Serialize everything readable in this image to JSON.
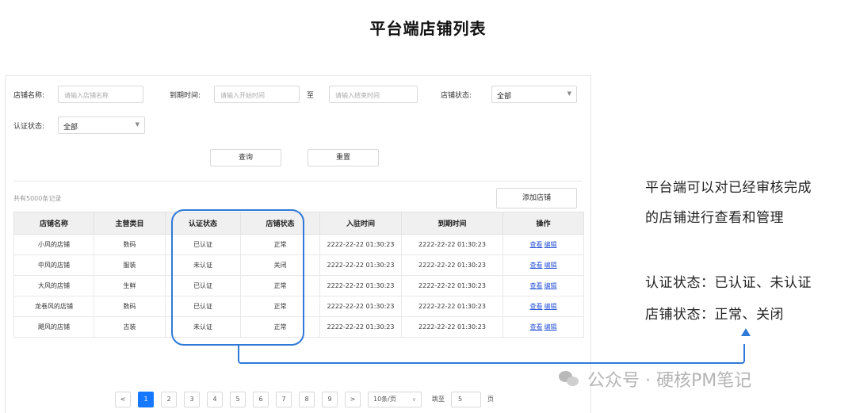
{
  "title": "平台端店铺列表",
  "filters": {
    "store_name_label": "店铺名称:",
    "store_name_placeholder": "请输入店铺名称",
    "expire_label": "到期时间:",
    "start_placeholder": "请输入开始时间",
    "to": "至",
    "end_placeholder": "请输入结束时间",
    "store_status_label": "店铺状态:",
    "store_status_value": "全部",
    "cert_status_label": "认证状态:",
    "cert_status_value": "全部"
  },
  "buttons": {
    "query": "查询",
    "reset": "重置",
    "add_store": "添加店铺"
  },
  "total_text": "共有5000条记录",
  "table": {
    "headers": [
      "店铺名称",
      "主营类目",
      "认证状态",
      "店铺状态",
      "入驻时间",
      "到期时间",
      "操作"
    ],
    "rows": [
      [
        "小风的店铺",
        "数码",
        "已认证",
        "正常",
        "2222-22-22 01:30:23",
        "2222-22-22 01:30:23"
      ],
      [
        "中风的店铺",
        "服装",
        "未认证",
        "关闭",
        "2222-22-22 01:30:23",
        "2222-22-22 01:30:23"
      ],
      [
        "大风的店铺",
        "生鲜",
        "已认证",
        "正常",
        "2222-22-22 01:30:23",
        "2222-22-22 01:30:23"
      ],
      [
        "龙卷风的店铺",
        "数码",
        "已认证",
        "正常",
        "2222-22-22 01:30:23",
        "2222-22-22 01:30:23"
      ],
      [
        "飓风的店铺",
        "古装",
        "未认证",
        "正常",
        "2222-22-22 01:30:23",
        "2222-22-22 01:30:23"
      ]
    ],
    "view_label": "查看",
    "edit_label": "编辑"
  },
  "annotations": {
    "line1": "平台端可以对已经审核完成",
    "line2": "的店铺进行查看和管理",
    "line3": "认证状态：已认证、未认证",
    "line4": "店铺状态：正常、关闭"
  },
  "pagination": {
    "prev": "<",
    "pages": [
      "1",
      "2",
      "3",
      "4",
      "5",
      "6",
      "7",
      "8",
      "9"
    ],
    "next": ">",
    "current_page": "1",
    "page_size": "10条/页",
    "jump_label": "跳至",
    "jump_value": "5",
    "page_unit": "页"
  },
  "watermark": "公众号 · 硬核PM笔记",
  "colors": {
    "accent": "#2f7ad8",
    "link": "#2b56d6",
    "active_page": "#1677ff"
  }
}
